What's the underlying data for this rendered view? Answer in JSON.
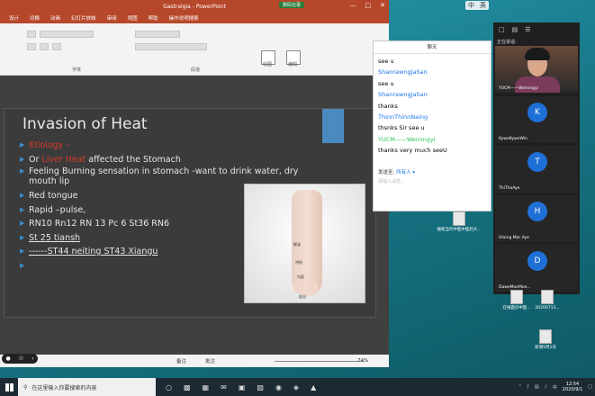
{
  "ppt": {
    "title": "Gastralgia - PowerPoint",
    "recording": "数码在录",
    "tabs": [
      "设计",
      "切换",
      "动画",
      "幻灯片放映",
      "审阅",
      "视图",
      "帮助",
      "操作说明搜索"
    ],
    "groups": {
      "font": "字体",
      "paragraph": "段落",
      "find": "绘图",
      "edit": "编辑"
    },
    "status": {
      "notes": "备注",
      "comments": "批注",
      "zoom": "74%"
    }
  },
  "slide": {
    "title": "Invasion of Heat",
    "bullets": [
      {
        "red": "Etiology -",
        "rest": ""
      },
      {
        "prefix": "Or ",
        "red": "Liver Heat",
        "rest": " affected the Stomach"
      },
      {
        "rest": "Feeling Burning sensation in stomach  -want to drink water, dry mouth lip"
      },
      {
        "rest": "Red tongue"
      },
      {
        "rest": "Rapid –pulse,"
      },
      {
        "rest": "RN10 Rn12 RN 13 Pc 6 St36 RN6"
      },
      {
        "rest": "St 25 tiansh"
      },
      {
        "rest": "------ST44 neiting ST43 Xiangu"
      },
      {
        "rest": ""
      }
    ],
    "foot_labels": [
      "解溪",
      "冲阳",
      "内庭",
      "陷谷"
    ]
  },
  "chat": {
    "title": "聊天",
    "messages": [
      {
        "text": "see u"
      },
      {
        "name": "ShanrawngJaSan"
      },
      {
        "text": "see u"
      },
      {
        "name": "ShanrawngJaSan"
      },
      {
        "text": "thanks"
      },
      {
        "name": "ThinnThinnNaing"
      },
      {
        "text": "thsnks Sir see u"
      },
      {
        "name": "YUCM——Weiningyi",
        "green": true
      },
      {
        "text": "thanks  very much seeU"
      }
    ],
    "send_to": "发送至:",
    "send_target": "所有人",
    "placeholder": "请输入消息..."
  },
  "video": {
    "speaking": "正在讲话:",
    "main_name": "YUCM——Weiningyi",
    "tiles": [
      {
        "initial": "K",
        "name": "KyweKyweWin"
      },
      {
        "initial": "T",
        "name": "ThiThaAye"
      },
      {
        "initial": "H",
        "name": "Hlaing Mar Aye"
      },
      {
        "initial": "D",
        "name": "DaweMoeMoe..."
      }
    ]
  },
  "desktop": {
    "icons": [
      "缅甸当代中医中医药大...",
      "在线面诊中医...",
      "20200713...",
      "新增9月2日"
    ]
  },
  "taskbar": {
    "search_placeholder": "在这里输入你要搜索的内容",
    "time": "12:54",
    "date": "2020/9/1"
  },
  "ime": {
    "lang": "中",
    "mode": "英"
  }
}
